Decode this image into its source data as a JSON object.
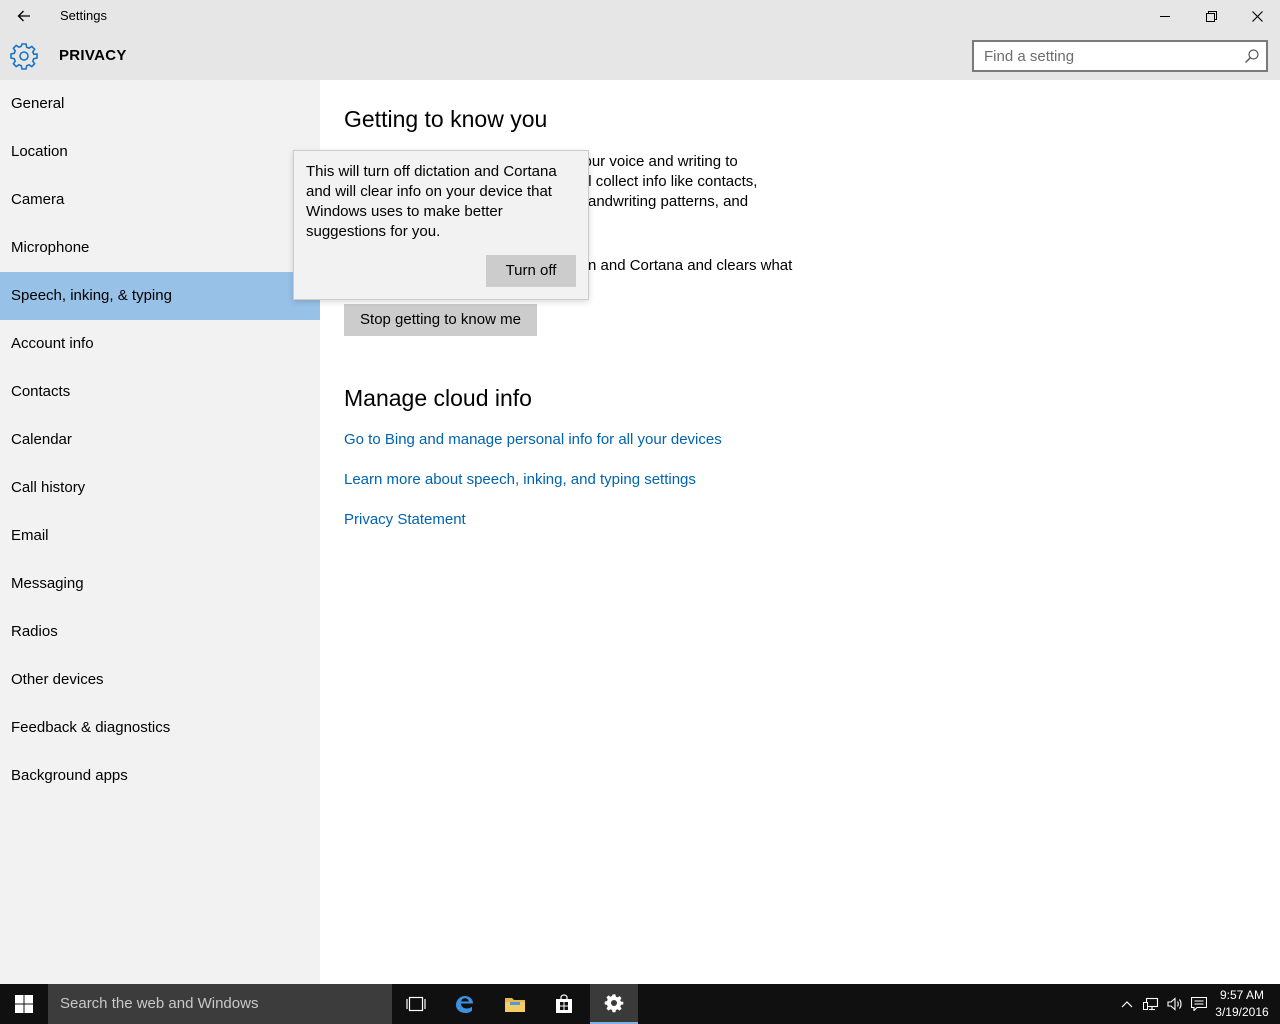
{
  "window": {
    "title": "Settings",
    "minimize_glyph": "—",
    "restore_icon": "restore-icon",
    "close_glyph": "✕"
  },
  "header": {
    "title": "PRIVACY",
    "search_placeholder": "Find a setting"
  },
  "sidebar": {
    "items": [
      {
        "label": "General"
      },
      {
        "label": "Location"
      },
      {
        "label": "Camera"
      },
      {
        "label": "Microphone"
      },
      {
        "label": "Speech, inking, & typing",
        "selected": true
      },
      {
        "label": "Account info"
      },
      {
        "label": "Contacts"
      },
      {
        "label": "Calendar"
      },
      {
        "label": "Call history"
      },
      {
        "label": "Email"
      },
      {
        "label": "Messaging"
      },
      {
        "label": "Radios"
      },
      {
        "label": "Other devices"
      },
      {
        "label": "Feedback & diagnostics"
      },
      {
        "label": "Background apps"
      }
    ]
  },
  "main": {
    "section1_title": "Getting to know you",
    "visible_text": {
      "line1": "w your voice and writing to",
      "line2": "'ll collect info like contacts,",
      "line3": "andwriting patterns, and",
      "line4": "n and Cortana and clears what"
    },
    "stop_button": "Stop getting to know me",
    "section2_title": "Manage cloud info",
    "links": [
      "Go to Bing and manage personal info for all your devices",
      "Learn more about speech, inking, and typing settings",
      "Privacy Statement"
    ]
  },
  "flyout": {
    "message": "This will turn off dictation and Cortana and will clear info on your device that Windows uses to make better suggestions for you.",
    "button": "Turn off"
  },
  "taskbar": {
    "search_placeholder": "Search the web and Windows",
    "time": "9:57 AM",
    "date": "3/19/2016"
  },
  "colors": {
    "accent": "#0063b1",
    "selected_nav": "#97c1e6",
    "header_bg": "#e6e6e6",
    "sidebar_bg": "#f2f2f2"
  }
}
